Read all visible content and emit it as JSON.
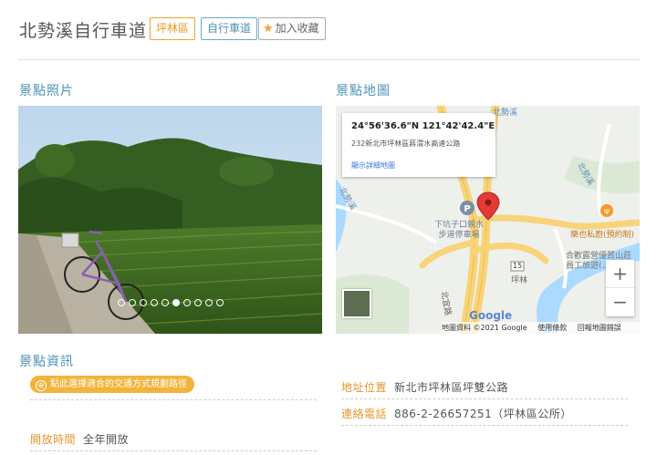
{
  "header": {
    "title": "北勢溪自行車道",
    "tags": {
      "district": "坪林區",
      "category": "自行車道",
      "favorite": "加入收藏"
    }
  },
  "photo_section": {
    "title": "景點照片",
    "carousel": {
      "total": 10,
      "active": 5
    }
  },
  "map_section": {
    "title": "景點地圖",
    "card": {
      "coordinates": "24°56'36.6\"N 121°42'42.4\"E",
      "address": "232新北市坪林區蔣渭水高速公路",
      "link": "顯示詳細地圖"
    },
    "labels": {
      "parking": "下坑子口親水\n步道停車場",
      "restaurant": "樂也私廚(預約制)",
      "camp": "合歡露營優質山莊\n員工旅遊(...)",
      "river_north": "北勢溪",
      "river_left": "北勢溪",
      "river_top": "北勢溪",
      "road_left": "北宜路",
      "route_number": "15",
      "town": "坪林"
    },
    "zoom_in": "+",
    "zoom_out": "−",
    "logo": "Google",
    "footer": [
      "地圖資料 ©2021 Google",
      "使用條款",
      "回報地圖錯誤"
    ]
  },
  "info_section": {
    "title": "景點資訊",
    "route_button": "點此選擇適合的交通方式規劃路徑",
    "opening": {
      "label": "開放時間",
      "value": "全年開放"
    },
    "address": {
      "label": "地址位置",
      "value": "新北市坪林區坪雙公路"
    },
    "phone": {
      "label": "連絡電話",
      "value": "886-2-26657251（坪林區公所）"
    }
  },
  "colors": {
    "accent_orange": "#e8952a",
    "accent_blue": "#4d93b8",
    "pill": "#f2b43a",
    "map_marker": "#e53935"
  }
}
